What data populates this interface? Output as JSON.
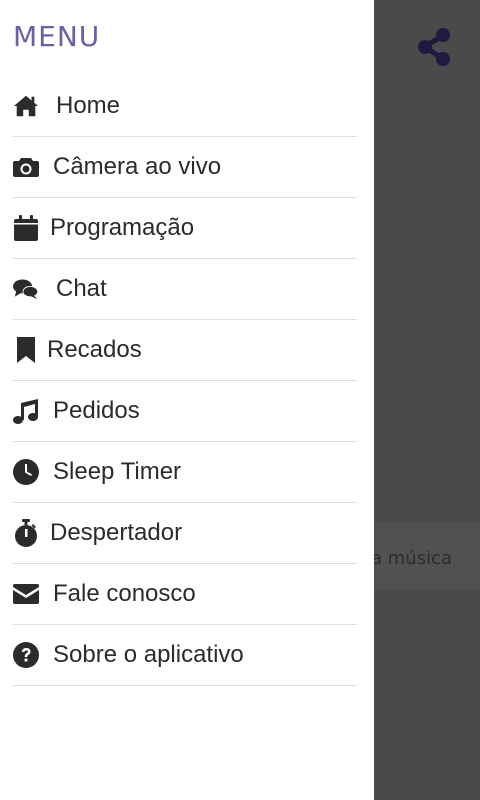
{
  "header": {
    "title": "MENU",
    "share_icon": "share-icon"
  },
  "menu": {
    "items": [
      {
        "label": "Home",
        "icon": "home-icon"
      },
      {
        "label": "Câmera ao vivo",
        "icon": "camera-icon"
      },
      {
        "label": "Programação",
        "icon": "calendar-icon"
      },
      {
        "label": "Chat",
        "icon": "chat-icon"
      },
      {
        "label": "Recados",
        "icon": "bookmark-icon"
      },
      {
        "label": "Pedidos",
        "icon": "music-icon"
      },
      {
        "label": "Sleep Timer",
        "icon": "clock-icon"
      },
      {
        "label": "Despertador",
        "icon": "stopwatch-icon"
      },
      {
        "label": "Fale conosco",
        "icon": "envelope-icon"
      },
      {
        "label": "Sobre o aplicativo",
        "icon": "question-icon"
      }
    ]
  },
  "background": {
    "strip_text": "a música"
  },
  "colors": {
    "menu_title": "#6a5fa8",
    "share_icon": "#1e1a40",
    "overlay": "#4a4a4a",
    "drawer": "#ffffff",
    "text": "#2b2b2b"
  }
}
